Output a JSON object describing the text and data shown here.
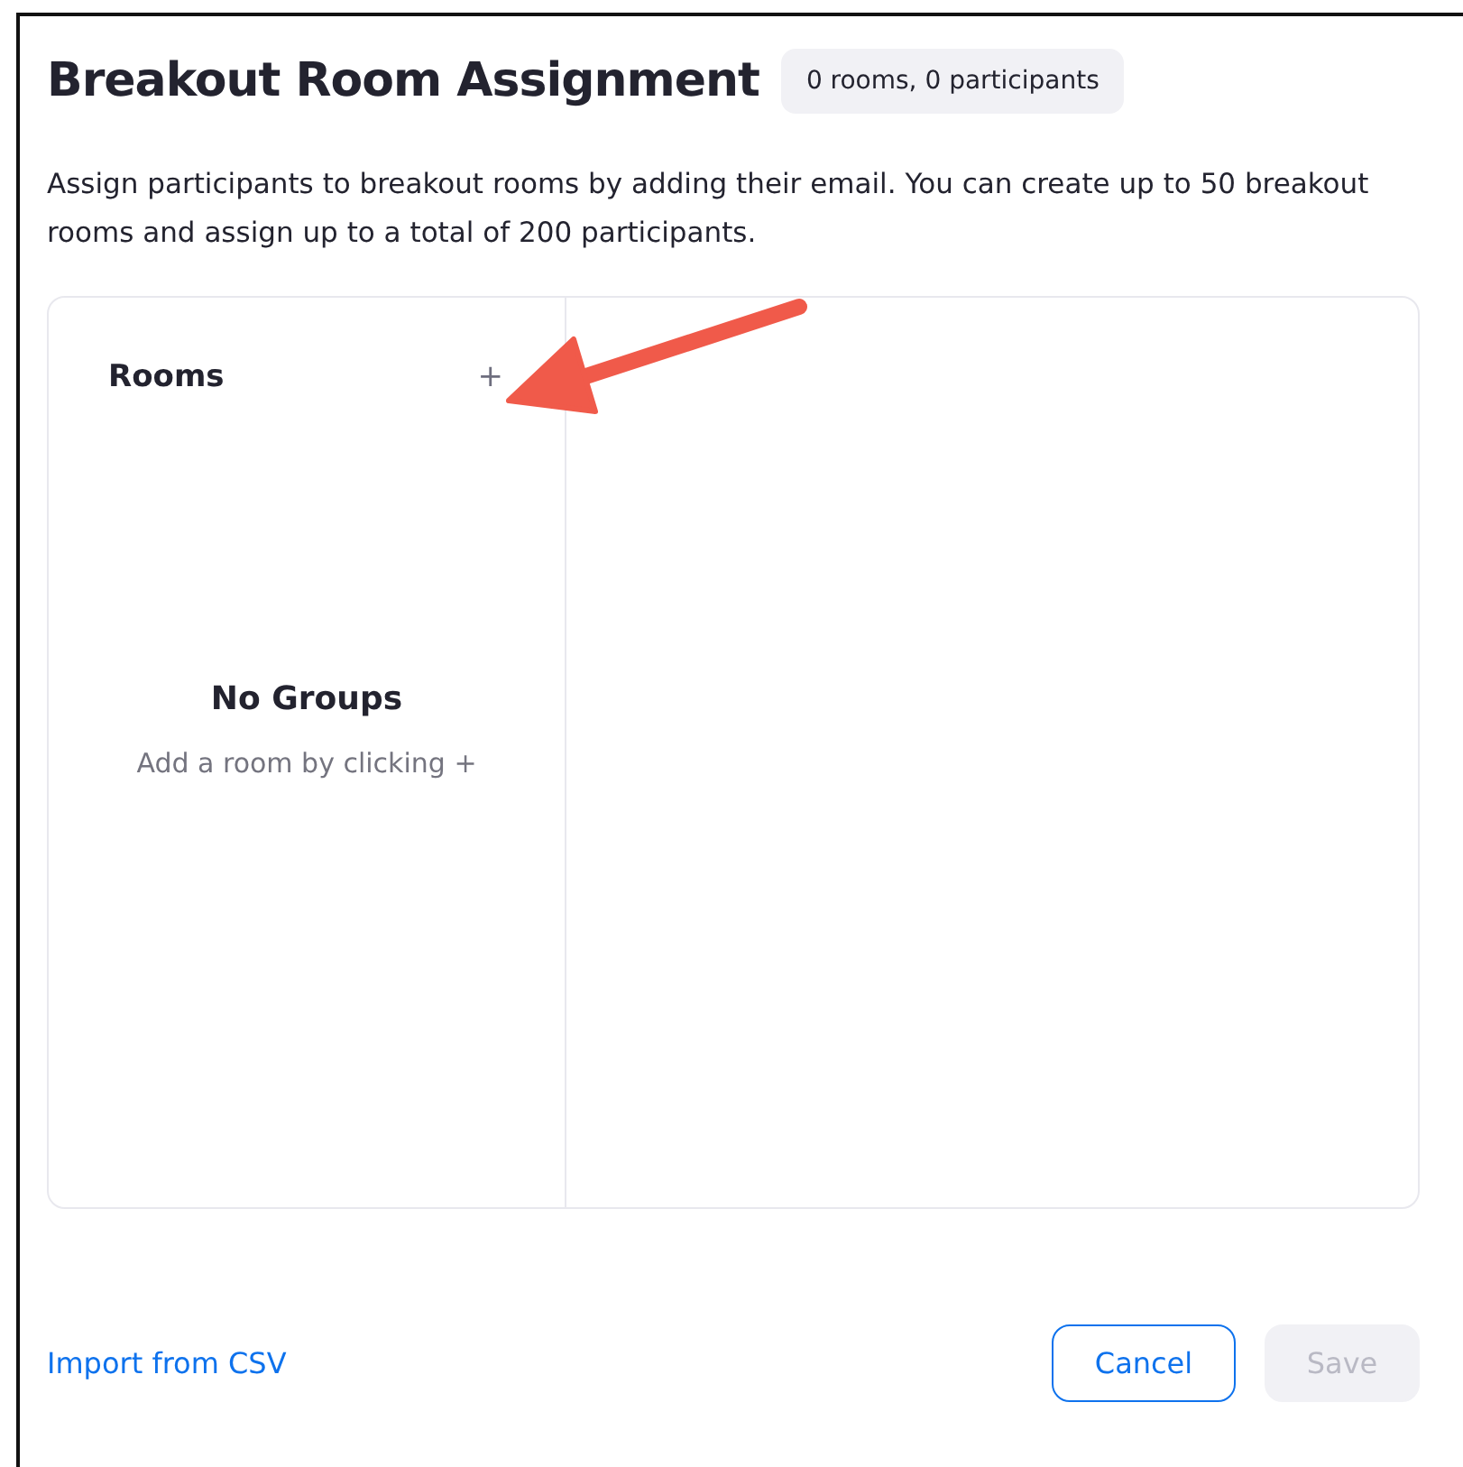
{
  "dialog": {
    "title": "Breakout Room Assignment",
    "summary_badge": "0 rooms, 0 participants",
    "description": "Assign participants to breakout rooms by adding their email. You can create up to 50 breakout rooms and assign up to a total of 200 participants."
  },
  "rooms_panel": {
    "heading": "Rooms",
    "add_button": "+",
    "empty_title": "No Groups",
    "empty_hint": "Add a room by clicking +"
  },
  "footer": {
    "import_link": "Import from CSV",
    "buttons": [
      {
        "label": "Cancel",
        "kind": "secondary",
        "disabled": false
      },
      {
        "label": "Save",
        "kind": "primary",
        "disabled": true
      }
    ]
  }
}
